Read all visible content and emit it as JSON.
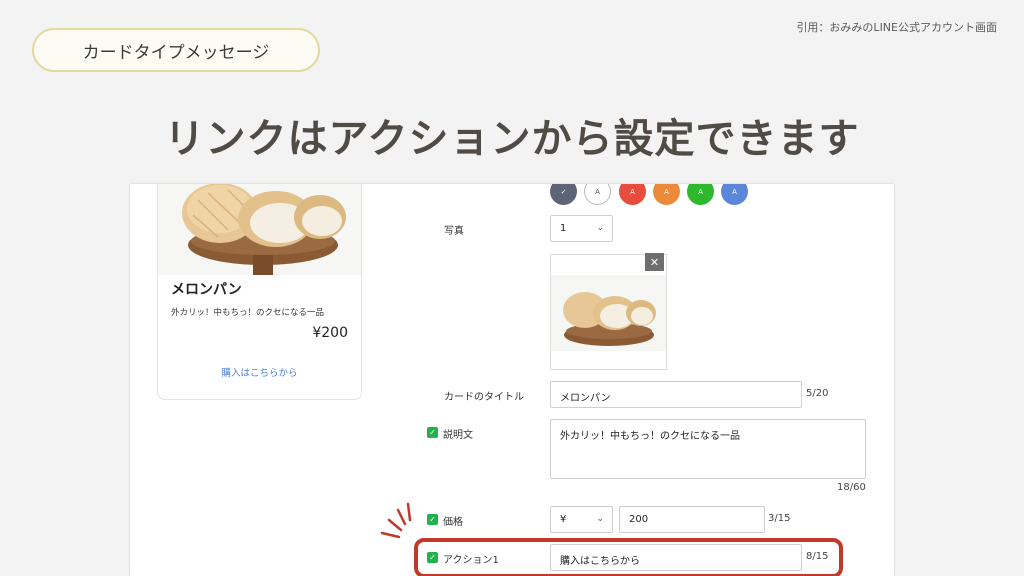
{
  "credit": "引用：おみみのLINE公式アカウント画面",
  "pill_label": "カードタイプメッセージ",
  "headline": "リンクはアクションから設定できます",
  "card": {
    "title": "メロンパン",
    "description": "外カリッ！中もちっ！のクセになる一品",
    "price": "¥200",
    "link": "購入はこちらから"
  },
  "colors": {
    "swatches": [
      "#5d6478",
      "#ffffff",
      "#e74c3c",
      "#ea8a3a",
      "#2eb82e",
      "#5b87d8"
    ],
    "swatch_letter": "A",
    "accent_highlight": "#c0392b",
    "check_green": "#22b24c",
    "link_blue": "#4a7fd6"
  },
  "form": {
    "photo_label": "写真",
    "photo_count": "1",
    "title_label": "カードのタイトル",
    "title_value": "メロンパン",
    "title_counter": "5/20",
    "desc_label": "説明文",
    "desc_value": "外カリッ！中もちっ！のクセになる一品",
    "desc_counter": "18/60",
    "price_label": "価格",
    "currency": "¥",
    "price_value": "200",
    "price_counter": "3/15",
    "action_label": "アクション1",
    "action_value": "購入はこちらから",
    "action_counter": "8/15"
  }
}
